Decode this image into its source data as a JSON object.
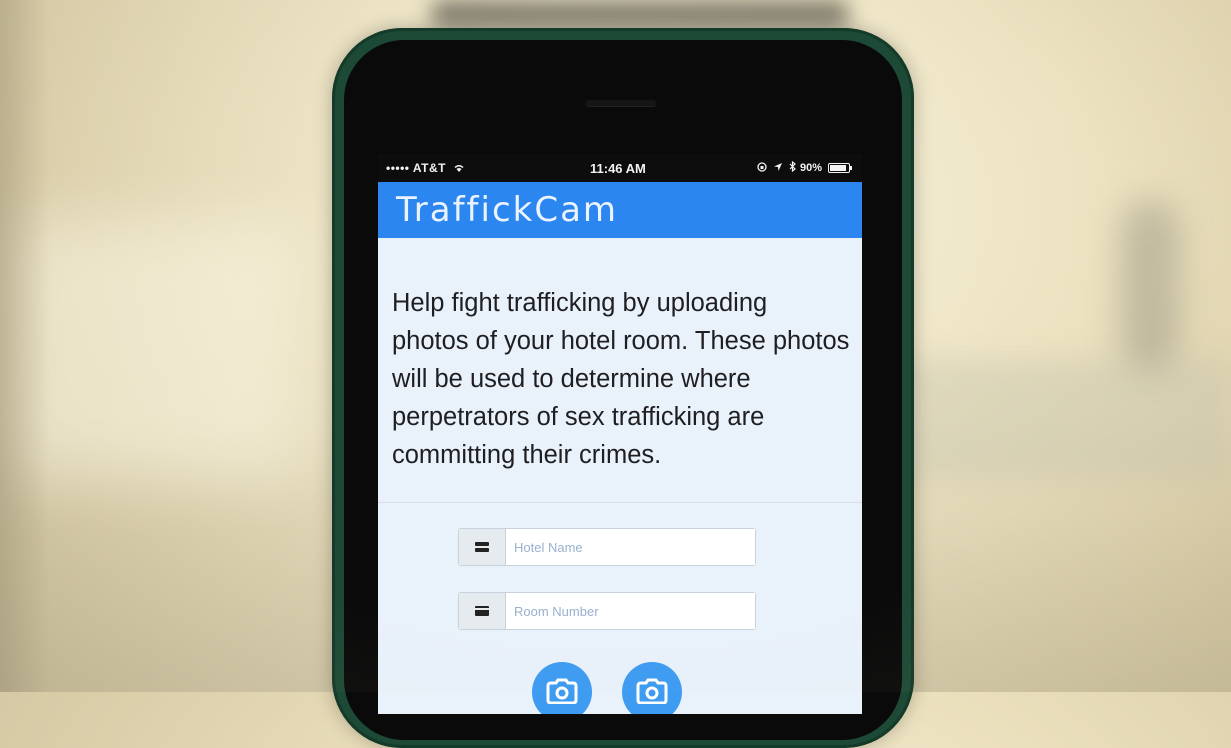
{
  "status_bar": {
    "carrier": "••••• AT&T",
    "time": "11:46 AM",
    "battery_percent": "90%",
    "battery_level": 0.9
  },
  "app": {
    "title": "TraffickCam",
    "accent_color": "#2c86ef"
  },
  "intro": {
    "text": "Help fight trafficking by uploading photos of your hotel room. These photos will be used to determine where perpetrators of sex trafficking are committing their crimes."
  },
  "form": {
    "hotel_name": {
      "placeholder": "Hotel Name",
      "value": "",
      "icon": "building-icon"
    },
    "room_number": {
      "placeholder": "Room Number",
      "value": "",
      "icon": "card-icon"
    }
  },
  "actions": {
    "camera_buttons": [
      {
        "icon": "camera-icon"
      },
      {
        "icon": "camera-icon"
      }
    ]
  }
}
